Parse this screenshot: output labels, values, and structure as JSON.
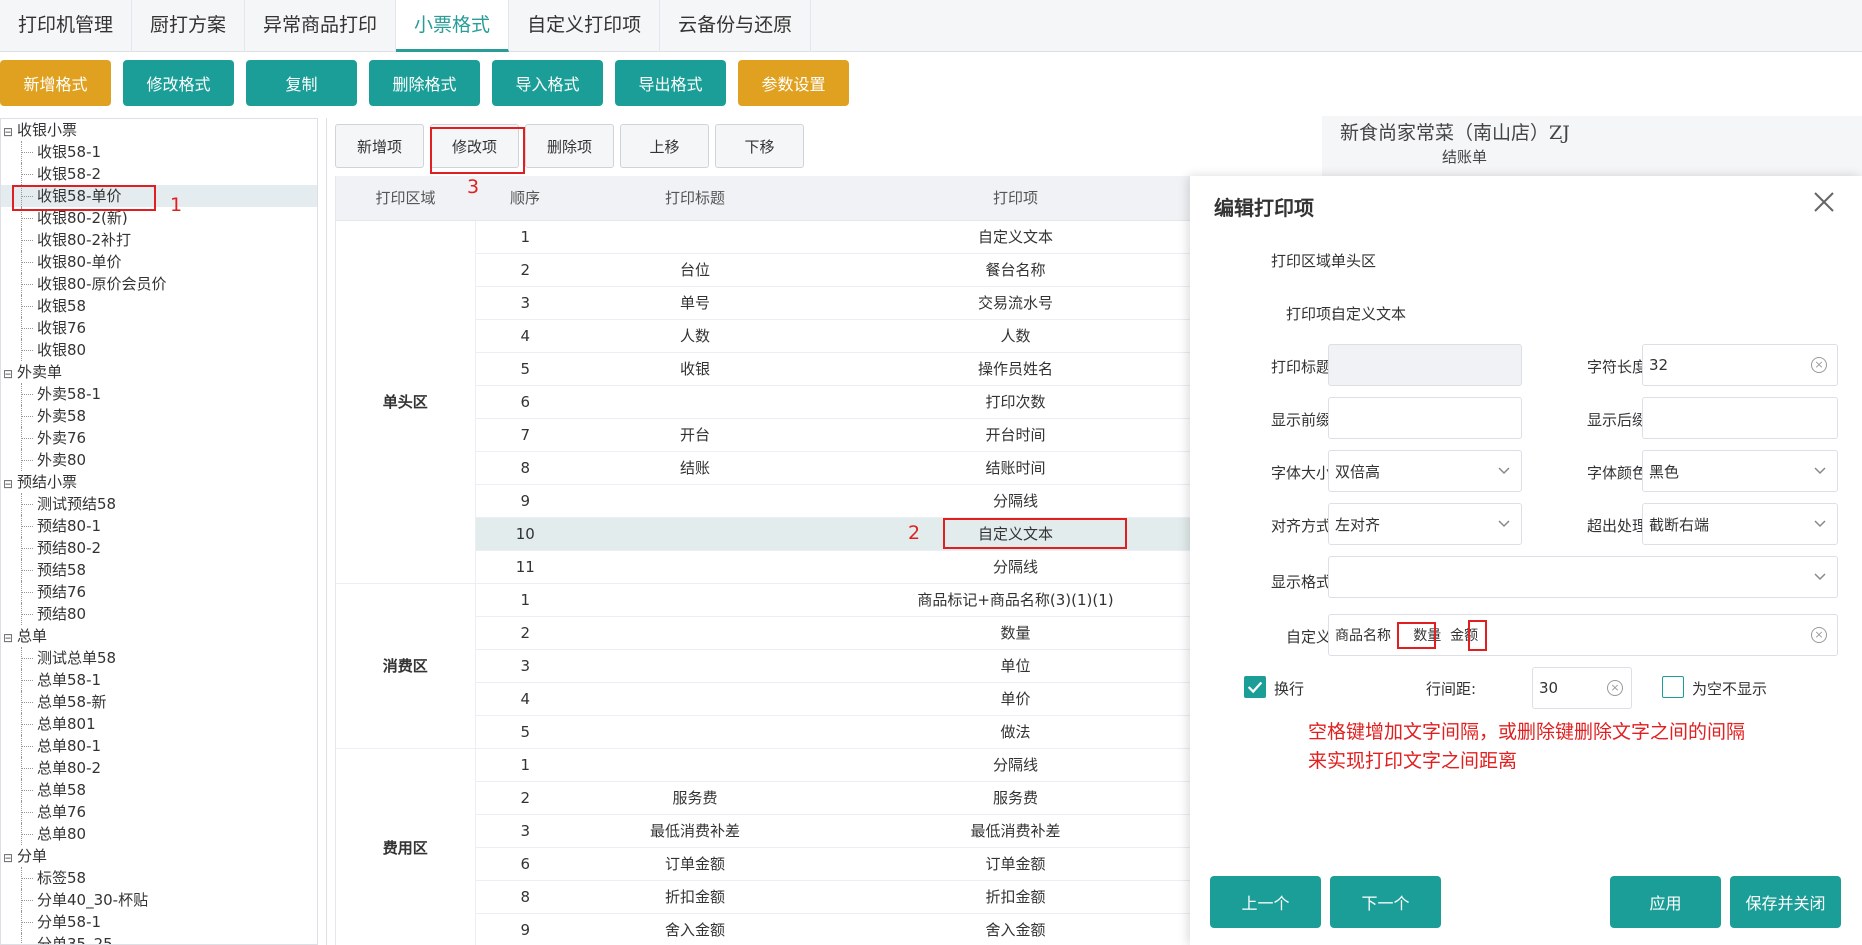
{
  "topnav": {
    "tabs": [
      {
        "label": "打印机管理",
        "active": false
      },
      {
        "label": "厨打方案",
        "active": false
      },
      {
        "label": "异常商品打印",
        "active": false
      },
      {
        "label": "小票格式",
        "active": true
      },
      {
        "label": "自定义打印项",
        "active": false
      },
      {
        "label": "云备份与还原",
        "active": false
      }
    ]
  },
  "toolbar": {
    "buttons": [
      {
        "label": "新增格式",
        "color": "orange"
      },
      {
        "label": "修改格式",
        "color": "teal"
      },
      {
        "label": "复制",
        "color": "teal"
      },
      {
        "label": "删除格式",
        "color": "teal"
      },
      {
        "label": "导入格式",
        "color": "teal"
      },
      {
        "label": "导出格式",
        "color": "teal"
      },
      {
        "label": "参数设置",
        "color": "orange"
      }
    ]
  },
  "tree": {
    "groups": [
      {
        "label": "收银小票",
        "items": [
          "收银58-1",
          "收银58-2",
          "收银58-单价",
          "收银80-2(新)",
          "收银80-2补打",
          "收银80-单价",
          "收银80-原价会员价",
          "收银58",
          "收银76",
          "收银80"
        ]
      },
      {
        "label": "外卖单",
        "items": [
          "外卖58-1",
          "外卖58",
          "外卖76",
          "外卖80"
        ]
      },
      {
        "label": "预结小票",
        "items": [
          "测试预结58",
          "预结80-1",
          "预结80-2",
          "预结58",
          "预结76",
          "预结80"
        ]
      },
      {
        "label": "总单",
        "items": [
          "测试总单58",
          "总单58-1",
          "总单58-新",
          "总单801",
          "总单80-1",
          "总单80-2",
          "总单58",
          "总单76",
          "总单80"
        ]
      },
      {
        "label": "分单",
        "items": [
          "标签58",
          "分单40_30-杯贴",
          "分单58-1",
          "分单35_25"
        ]
      }
    ],
    "selected": "收银58-单价"
  },
  "subtoolbar": {
    "buttons": [
      "新增项",
      "修改项",
      "删除项",
      "上移",
      "下移"
    ]
  },
  "grid": {
    "headers": [
      "打印区域",
      "顺序",
      "打印标题",
      "打印项"
    ],
    "sections": [
      {
        "area": "单头区",
        "rows": [
          {
            "order": "1",
            "title": "",
            "item": "自定义文本"
          },
          {
            "order": "2",
            "title": "台位",
            "item": "餐台名称"
          },
          {
            "order": "3",
            "title": "单号",
            "item": "交易流水号"
          },
          {
            "order": "4",
            "title": "人数",
            "item": "人数"
          },
          {
            "order": "5",
            "title": "收银",
            "item": "操作员姓名"
          },
          {
            "order": "6",
            "title": "",
            "item": "打印次数"
          },
          {
            "order": "7",
            "title": "开台",
            "item": "开台时间"
          },
          {
            "order": "8",
            "title": "结账",
            "item": "结账时间"
          },
          {
            "order": "9",
            "title": "",
            "item": "分隔线"
          },
          {
            "order": "10",
            "title": "",
            "item": "自定义文本",
            "highlight": true
          },
          {
            "order": "11",
            "title": "",
            "item": "分隔线"
          }
        ]
      },
      {
        "area": "消费区",
        "rows": [
          {
            "order": "1",
            "title": "",
            "item": "商品标记+商品名称(3)(1)(1)"
          },
          {
            "order": "2",
            "title": "",
            "item": "数量"
          },
          {
            "order": "3",
            "title": "",
            "item": "单位"
          },
          {
            "order": "4",
            "title": "",
            "item": "单价"
          },
          {
            "order": "5",
            "title": "",
            "item": "做法"
          }
        ]
      },
      {
        "area": "费用区",
        "rows": [
          {
            "order": "1",
            "title": "",
            "item": "分隔线"
          },
          {
            "order": "2",
            "title": "服务费",
            "item": "服务费"
          },
          {
            "order": "3",
            "title": "最低消费补差",
            "item": "最低消费补差"
          },
          {
            "order": "6",
            "title": "订单金额",
            "item": "订单金额"
          },
          {
            "order": "8",
            "title": "折扣金额",
            "item": "折扣金额"
          },
          {
            "order": "9",
            "title": "舍入金额",
            "item": "舍入金额"
          }
        ]
      }
    ]
  },
  "preview": {
    "line1": "新食尚家常菜（南山店）ZJ",
    "line2": "结账单"
  },
  "dialog": {
    "title": "编辑打印项",
    "area_label": "打印区域:",
    "area_value": "单头区",
    "item_label": "打印项:",
    "item_value": "自定义文本",
    "print_title_label": "打印标题:",
    "print_title_value": "",
    "char_len_label": "字符长度:",
    "char_len_value": "32",
    "prefix_label": "显示前缀:",
    "prefix_value": "",
    "suffix_label": "显示后缀:",
    "suffix_value": "",
    "font_size_label": "字体大小:",
    "font_size_value": "双倍高",
    "font_color_label": "字体颜色:",
    "font_color_value": "黑色",
    "align_label": "对齐方式:",
    "align_value": "左对齐",
    "overflow_label": "超出处理:",
    "overflow_value": "截断右端",
    "format_label": "显示格式:",
    "format_value": "",
    "custom_label": "自定义:",
    "custom_value": "商品名称     数量  金额",
    "wrap_label": "换行",
    "wrap_checked": true,
    "line_spacing_label": "行间距:",
    "line_spacing_value": "30",
    "hide_empty_label": "为空不显示",
    "hide_empty_checked": false,
    "note_line1": "空格键增加文字间隔，或删除键删除文字之间的间隔",
    "note_line2": "来实现打印文字之间距离",
    "btn_prev": "上一个",
    "btn_next": "下一个",
    "btn_apply": "应用",
    "btn_save_close": "保存并关闭"
  },
  "annotations": [
    "1",
    "2",
    "3"
  ],
  "colors": {
    "accent": "#1b9e97",
    "orange": "#e0a020",
    "annotation": "#e02020"
  }
}
